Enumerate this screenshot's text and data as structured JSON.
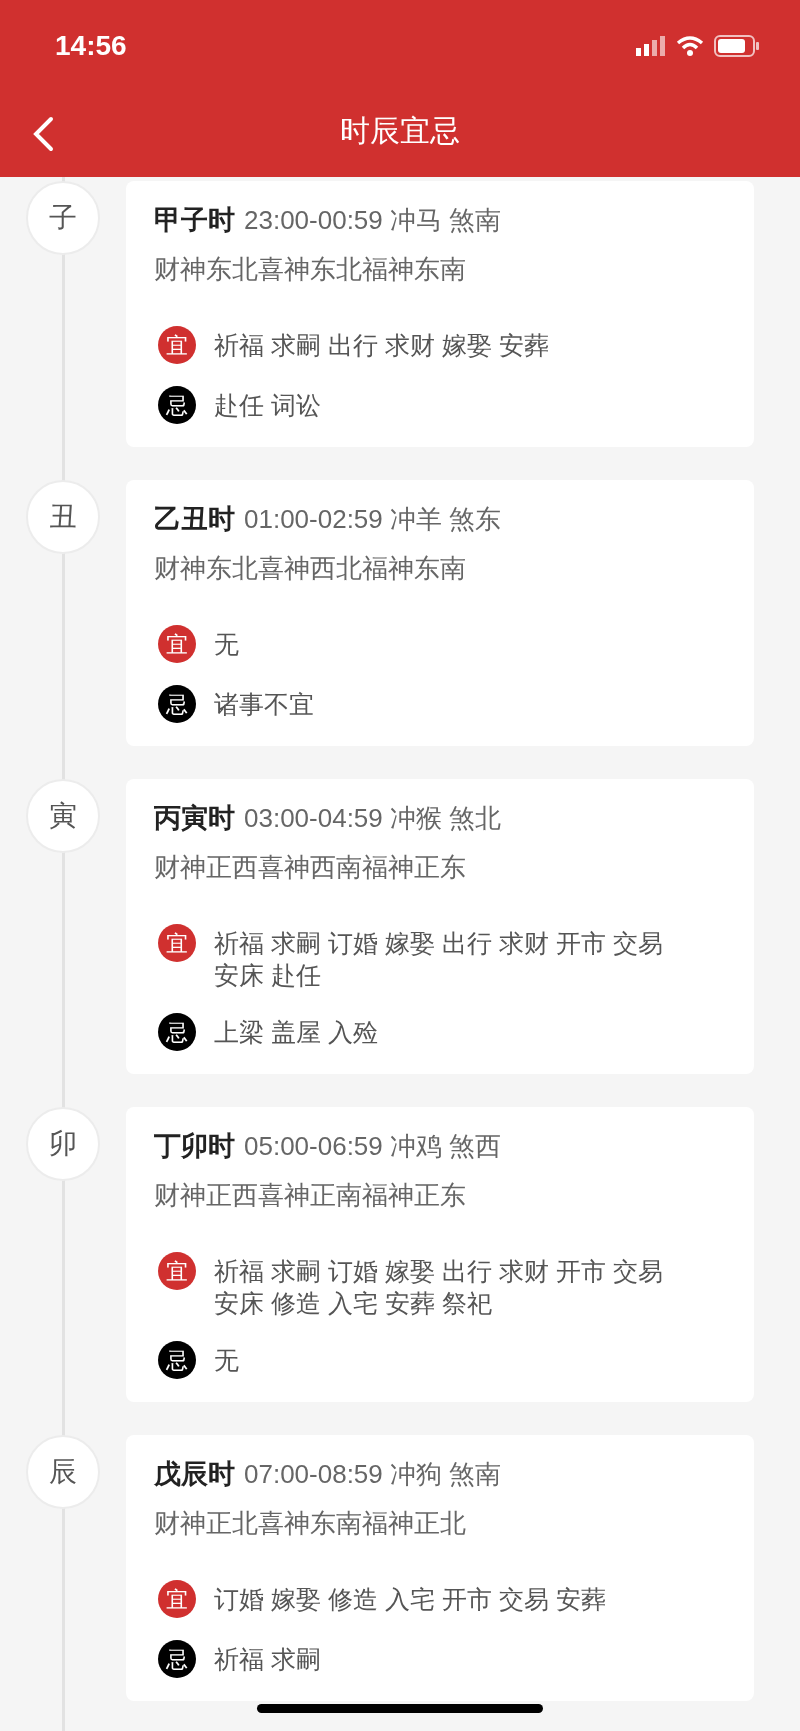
{
  "status_bar": {
    "time": "14:56"
  },
  "header": {
    "title": "时辰宜忌"
  },
  "hours": [
    {
      "branch": "子",
      "name": "甲子时",
      "detail": "23:00-00:59 冲马 煞南",
      "gods": "财神东北喜神东北福神东南",
      "rows": [
        {
          "kind": "yi",
          "badge": "宜",
          "text": "祈福 求嗣 出行 求财 嫁娶 安葬"
        },
        {
          "kind": "ji",
          "badge": "忌",
          "text": "赴任 词讼"
        }
      ]
    },
    {
      "branch": "丑",
      "name": "乙丑时",
      "detail": "01:00-02:59 冲羊 煞东",
      "gods": "财神东北喜神西北福神东南",
      "rows": [
        {
          "kind": "yi",
          "badge": "宜",
          "text": "无"
        },
        {
          "kind": "ji",
          "badge": "忌",
          "text": "诸事不宜"
        }
      ]
    },
    {
      "branch": "寅",
      "name": "丙寅时",
      "detail": "03:00-04:59 冲猴 煞北",
      "gods": "财神正西喜神西南福神正东",
      "rows": [
        {
          "kind": "yi",
          "badge": "宜",
          "text": "祈福 求嗣 订婚 嫁娶 出行 求财 开市 交易安床 赴任"
        },
        {
          "kind": "ji",
          "badge": "忌",
          "text": "上梁 盖屋 入殓"
        }
      ]
    },
    {
      "branch": "卯",
      "name": "丁卯时",
      "detail": "05:00-06:59 冲鸡 煞西",
      "gods": "财神正西喜神正南福神正东",
      "rows": [
        {
          "kind": "yi",
          "badge": "宜",
          "text": "祈福 求嗣 订婚 嫁娶 出行 求财 开市 交易安床 修造 入宅 安葬 祭祀"
        },
        {
          "kind": "ji",
          "badge": "忌",
          "text": "无"
        }
      ]
    },
    {
      "branch": "辰",
      "name": "戊辰时",
      "detail": "07:00-08:59 冲狗 煞南",
      "gods": "财神正北喜神东南福神正北",
      "rows": [
        {
          "kind": "yi",
          "badge": "宜",
          "text": "订婚 嫁娶 修造 入宅 开市 交易 安葬"
        },
        {
          "kind": "ji",
          "badge": "忌",
          "text": "祈福 求嗣"
        }
      ]
    }
  ]
}
